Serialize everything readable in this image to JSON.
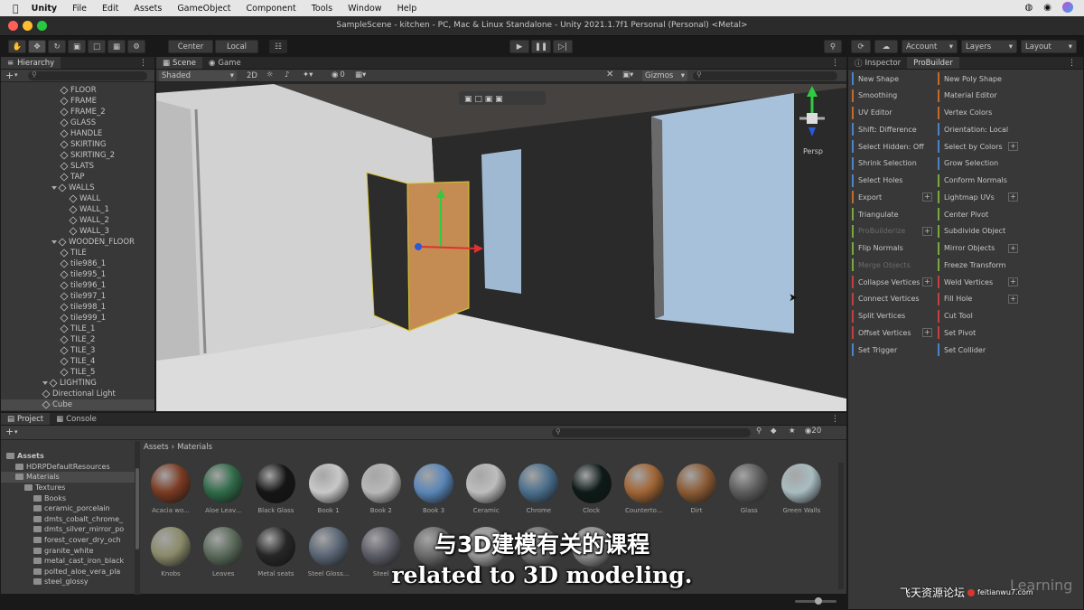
{
  "mac_menu": {
    "app_name": "Unity",
    "items": [
      "File",
      "Edit",
      "Assets",
      "GameObject",
      "Component",
      "Tools",
      "Window",
      "Help"
    ]
  },
  "window": {
    "title": "SampleScene - kitchen - PC, Mac & Linux Standalone - Unity 2021.1.7f1 Personal (Personal) <Metal>"
  },
  "toolbar": {
    "pivot_label": "Center",
    "space_label": "Local",
    "account_label": "Account",
    "layers_label": "Layers",
    "layout_label": "Layout"
  },
  "hierarchy": {
    "tab_label": "Hierarchy",
    "items": [
      {
        "label": "FLOOR",
        "depth": 2,
        "arrow": false
      },
      {
        "label": "FRAME",
        "depth": 2,
        "arrow": false
      },
      {
        "label": "FRAME_2",
        "depth": 2,
        "arrow": false
      },
      {
        "label": "GLASS",
        "depth": 2,
        "arrow": false
      },
      {
        "label": "HANDLE",
        "depth": 2,
        "arrow": false
      },
      {
        "label": "SKIRTING",
        "depth": 2,
        "arrow": false
      },
      {
        "label": "SKIRTING_2",
        "depth": 2,
        "arrow": false
      },
      {
        "label": "SLATS",
        "depth": 2,
        "arrow": false
      },
      {
        "label": "TAP",
        "depth": 2,
        "arrow": false
      },
      {
        "label": "WALLS",
        "depth": 1,
        "arrow": true
      },
      {
        "label": "WALL",
        "depth": 3,
        "arrow": false
      },
      {
        "label": "WALL_1",
        "depth": 3,
        "arrow": false
      },
      {
        "label": "WALL_2",
        "depth": 3,
        "arrow": false
      },
      {
        "label": "WALL_3",
        "depth": 3,
        "arrow": false
      },
      {
        "label": "WOODEN_FLOOR",
        "depth": 1,
        "arrow": true
      },
      {
        "label": "TILE",
        "depth": 2,
        "arrow": false
      },
      {
        "label": "tile986_1",
        "depth": 2,
        "arrow": false
      },
      {
        "label": "tile995_1",
        "depth": 2,
        "arrow": false
      },
      {
        "label": "tile996_1",
        "depth": 2,
        "arrow": false
      },
      {
        "label": "tile997_1",
        "depth": 2,
        "arrow": false
      },
      {
        "label": "tile998_1",
        "depth": 2,
        "arrow": false
      },
      {
        "label": "tile999_1",
        "depth": 2,
        "arrow": false
      },
      {
        "label": "TILE_1",
        "depth": 2,
        "arrow": false
      },
      {
        "label": "TILE_2",
        "depth": 2,
        "arrow": false
      },
      {
        "label": "TILE_3",
        "depth": 2,
        "arrow": false
      },
      {
        "label": "TILE_4",
        "depth": 2,
        "arrow": false
      },
      {
        "label": "TILE_5",
        "depth": 2,
        "arrow": false
      },
      {
        "label": "LIGHTING",
        "depth": 0,
        "arrow": true
      },
      {
        "label": "Directional Light",
        "depth": 0,
        "arrow": false
      },
      {
        "label": "Cube",
        "depth": 0,
        "arrow": false,
        "selected": true
      }
    ]
  },
  "scene": {
    "tabs": [
      "Scene",
      "Game"
    ],
    "shading_mode": "Shaded",
    "mode_2d": "2D",
    "fx_count": "0",
    "gizmos_label": "Gizmos",
    "persp_label": "Persp"
  },
  "inspector": {
    "tabs": [
      "Inspector",
      "ProBuilder"
    ]
  },
  "probuilder": {
    "left": [
      {
        "label": "New Shape",
        "color": "#4a83c9"
      },
      {
        "label": "Smoothing",
        "color": "#c46a2a"
      },
      {
        "label": "UV Editor",
        "color": "#c46a2a"
      },
      {
        "label": "Shift: Difference",
        "color": "#4a83c9"
      },
      {
        "label": "Select Hidden: Off",
        "color": "#4a83c9"
      },
      {
        "label": "Shrink Selection",
        "color": "#4a83c9"
      },
      {
        "label": "Select Holes",
        "color": "#4a83c9"
      },
      {
        "label": "Export",
        "color": "#c46a2a",
        "plus": true
      },
      {
        "label": "Triangulate",
        "color": "#7aa83a"
      },
      {
        "label": "ProBuilderize",
        "color": "#7aa83a",
        "dim": true,
        "plus": true
      },
      {
        "label": "Flip Normals",
        "color": "#7aa83a"
      },
      {
        "label": "Merge Objects",
        "color": "#7aa83a",
        "dim": true
      },
      {
        "label": "Collapse Vertices",
        "color": "#c44040",
        "plus": true
      },
      {
        "label": "Connect Vertices",
        "color": "#c44040"
      },
      {
        "label": "Split Vertices",
        "color": "#c44040"
      },
      {
        "label": "Offset Vertices",
        "color": "#c44040",
        "plus": true
      },
      {
        "label": "Set Trigger",
        "color": "#4a83c9"
      }
    ],
    "right": [
      {
        "label": "New Poly Shape",
        "color": "#c46a2a"
      },
      {
        "label": "Material Editor",
        "color": "#c46a2a"
      },
      {
        "label": "Vertex Colors",
        "color": "#c46a2a"
      },
      {
        "label": "Orientation: Local",
        "color": "#4a83c9"
      },
      {
        "label": "Select by Colors",
        "color": "#4a83c9",
        "plus": true
      },
      {
        "label": "Grow Selection",
        "color": "#4a83c9"
      },
      {
        "label": "Conform Normals",
        "color": "#7aa83a"
      },
      {
        "label": "Lightmap UVs",
        "color": "#7aa83a",
        "plus": true
      },
      {
        "label": "Center Pivot",
        "color": "#7aa83a"
      },
      {
        "label": "Subdivide Object",
        "color": "#7aa83a"
      },
      {
        "label": "Mirror Objects",
        "color": "#7aa83a",
        "plus": true
      },
      {
        "label": "Freeze Transform",
        "color": "#7aa83a"
      },
      {
        "label": "Weld Vertices",
        "color": "#c44040",
        "plus": true
      },
      {
        "label": "Fill Hole",
        "color": "#c44040",
        "plus": true
      },
      {
        "label": "Cut Tool",
        "color": "#c44040"
      },
      {
        "label": "Set Pivot",
        "color": "#c44040"
      },
      {
        "label": "Set Collider",
        "color": "#4a83c9"
      }
    ]
  },
  "project": {
    "tabs": [
      "Project",
      "Console"
    ],
    "breadcrumb": [
      "Assets",
      "Materials"
    ],
    "hidden_count": "20",
    "tree": [
      {
        "label": "Assets",
        "depth": 0,
        "bold": true
      },
      {
        "label": "HDRPDefaultResources",
        "depth": 1
      },
      {
        "label": "Materials",
        "depth": 1,
        "selected": true
      },
      {
        "label": "Textures",
        "depth": 2
      },
      {
        "label": "Books",
        "depth": 3
      },
      {
        "label": "ceramic_porcelain",
        "depth": 3
      },
      {
        "label": "dmts_cobalt_chrome_",
        "depth": 3
      },
      {
        "label": "dmts_silver_mirror_po",
        "depth": 3
      },
      {
        "label": "forest_cover_dry_och",
        "depth": 3
      },
      {
        "label": "granite_white",
        "depth": 3
      },
      {
        "label": "metal_cast_iron_black",
        "depth": 3
      },
      {
        "label": "polted_aloe_vera_pla",
        "depth": 3
      },
      {
        "label": "steel_glossy",
        "depth": 3
      }
    ],
    "materials_row1": [
      {
        "label": "Acacia wo...",
        "color": "#7a3a22"
      },
      {
        "label": "Aloe Leav...",
        "color": "#2f6a48"
      },
      {
        "label": "Black Glass",
        "color": "#151515"
      },
      {
        "label": "Book 1",
        "color": "#c8c8c8"
      },
      {
        "label": "Book 2",
        "color": "#b8b8b8"
      },
      {
        "label": "Book 3",
        "color": "#5a86b8"
      },
      {
        "label": "Ceramic",
        "color": "#bdbdbd"
      },
      {
        "label": "Chrome",
        "color": "#4a6e8c"
      },
      {
        "label": "Clock",
        "color": "#0d1a18"
      },
      {
        "label": "Countertо...",
        "color": "#a06434"
      },
      {
        "label": "Dirt",
        "color": "#8a5a34"
      },
      {
        "label": "Glass",
        "color": "#5c5c5c"
      },
      {
        "label": "Green Walls",
        "color": "#a8bcc0"
      }
    ],
    "materials_row2": [
      {
        "label": "Knobs",
        "color": "#8a8a6a"
      },
      {
        "label": "Leaves",
        "color": "#5a6a5a"
      },
      {
        "label": "Metal seats",
        "color": "#262626"
      },
      {
        "label": "Steel Gloss...",
        "color": "#5a6676"
      },
      {
        "label": "Steel",
        "color": "#5c5c66"
      },
      {
        "label": "",
        "color": "#6a6a6a"
      },
      {
        "label": "",
        "color": "#9a9a9a"
      },
      {
        "label": "",
        "color": "#707070"
      },
      {
        "label": "",
        "color": "#909090"
      }
    ]
  },
  "subtitle": {
    "zh": "与3D建模有关的课程",
    "en": "related to 3D modeling."
  },
  "watermark": {
    "brand": "Learning",
    "site_text": "飞天资源论坛",
    "url": "feitianwu7.com"
  }
}
